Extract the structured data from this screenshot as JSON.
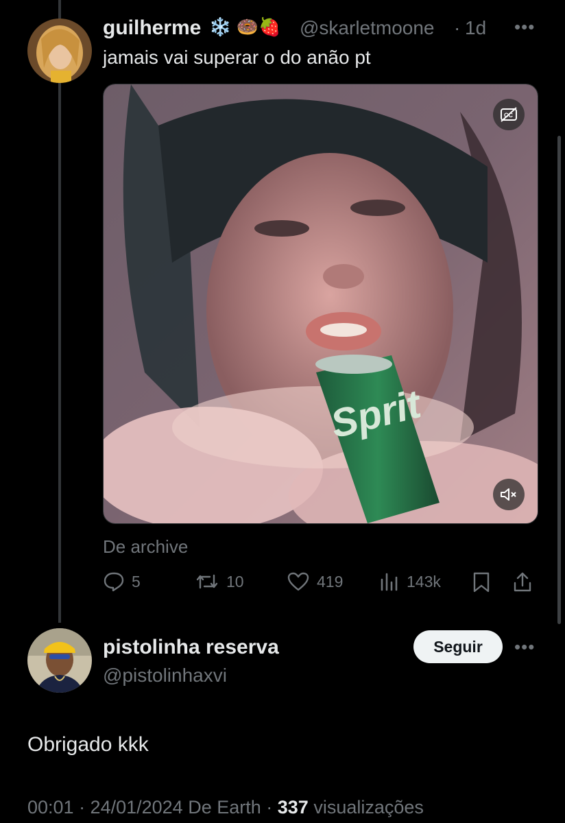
{
  "tweet": {
    "author_name": "guilherme",
    "author_emojis": "❄️ 🍩🍓",
    "handle": "@skarletmoone",
    "separator": "·",
    "time": "1d",
    "text": "jamais vai superar o do anão pt",
    "source": "De archive",
    "stats": {
      "replies": "5",
      "retweets": "10",
      "likes": "419",
      "views": "143k"
    },
    "media": {
      "can_text": "Sprit",
      "cc_icon": "closed-captions-icon",
      "mute_icon": "speaker-muted-icon"
    }
  },
  "reply": {
    "author_name": "pistolinha reserva",
    "handle": "@pistolinhaxvi",
    "follow_label": "Seguir",
    "text": "Obrigado kkk",
    "meta_time": "00:01 · 24/01/2024 De Earth ·",
    "views_count": "337",
    "views_label": "visualizações"
  },
  "colors": {
    "background": "#000000",
    "primary_text": "#e7e9ea",
    "secondary_text": "#71767b",
    "follow_button_bg": "#eff3f4"
  }
}
